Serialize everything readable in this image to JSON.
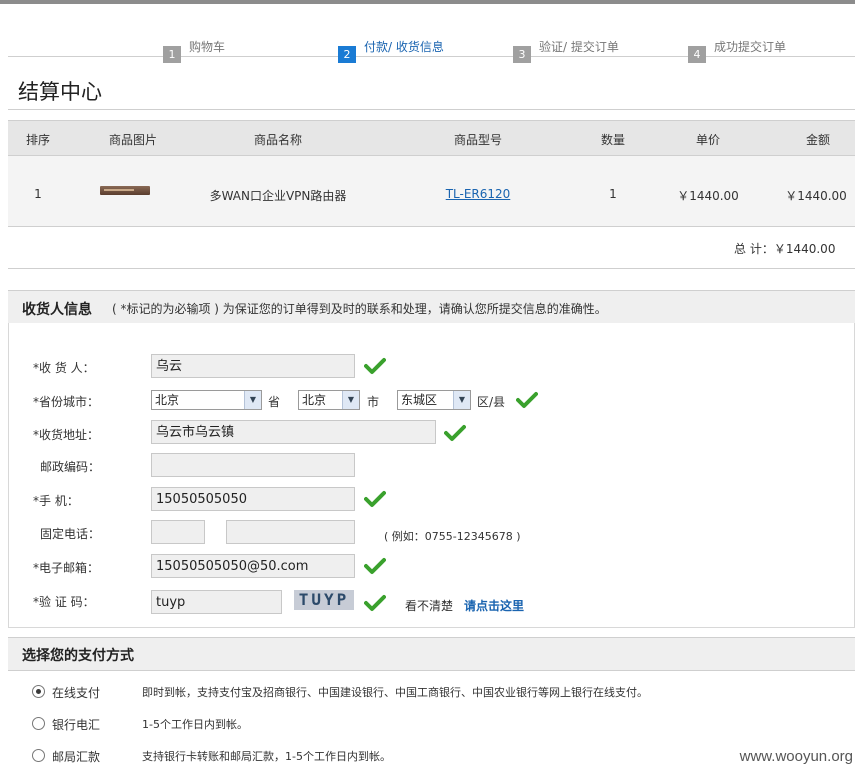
{
  "steps": [
    {
      "num": "1",
      "label": "购物车"
    },
    {
      "num": "2",
      "label": "付款/ 收货信息"
    },
    {
      "num": "3",
      "label": "验证/ 提交订单"
    },
    {
      "num": "4",
      "label": "成功提交订单"
    }
  ],
  "active_step": 2,
  "page_title": "结算中心",
  "cart": {
    "headers": [
      "排序",
      "商品图片",
      "商品名称",
      "商品型号",
      "数量",
      "单价",
      "金额"
    ],
    "rows": [
      {
        "index": "1",
        "image_icon": "router-image",
        "name": "多WAN口企业VPN路由器",
        "model": "TL-ER6120",
        "qty": "1",
        "price": "￥1440.00",
        "amount": "￥1440.00"
      }
    ],
    "total_label": "总  计：",
    "total_value": "￥1440.00"
  },
  "receiver": {
    "title": "收货人信息",
    "note": "( *标记的为必输项 ) 为保证您的订单得到及时的联系和处理，请确认您所提交信息的准确性。",
    "name_label": "*收 货 人：",
    "name_value": "乌云",
    "city_label": "*省份城市：",
    "province_value": "北京",
    "province_unit": "省",
    "city_value": "北京",
    "city_unit": "市",
    "district_value": "东城区",
    "district_unit": "区/县",
    "address_label": "*收货地址：",
    "address_value": "乌云市乌云镇",
    "zip_label": "邮政编码：",
    "zip_value": "",
    "mobile_label": "*手    机：",
    "mobile_value": "15050505050",
    "phone_label": "固定电话：",
    "phone_area": "",
    "phone_number": "",
    "phone_hint": "( 例如：0755-12345678 )",
    "email_label": "*电子邮箱：",
    "email_value": "15050505050@50.com",
    "captcha_label": "*验 证 码：",
    "captcha_value": "tuyp",
    "captcha_image_text": "TUYP",
    "captcha_unclear": "看不清楚",
    "captcha_refresh": "请点击这里",
    "check_icon": "check-icon"
  },
  "payment": {
    "title": "选择您的支付方式",
    "options": [
      {
        "name": "在线支付",
        "desc": "即时到帐，支持支付宝及招商银行、中国建设银行、中国工商银行、中国农业银行等网上银行在线支付。",
        "selected": true
      },
      {
        "name": "银行电汇",
        "desc": "1-5个工作日内到帐。",
        "selected": false
      },
      {
        "name": "邮局汇款",
        "desc": "支持银行卡转账和邮局汇款，1-5个工作日内到帐。",
        "selected": false
      }
    ]
  },
  "watermark": "www.wooyun.org",
  "colors": {
    "accent": "#1a7bd4",
    "link": "#1a64b0",
    "check": "#3aa12d"
  }
}
